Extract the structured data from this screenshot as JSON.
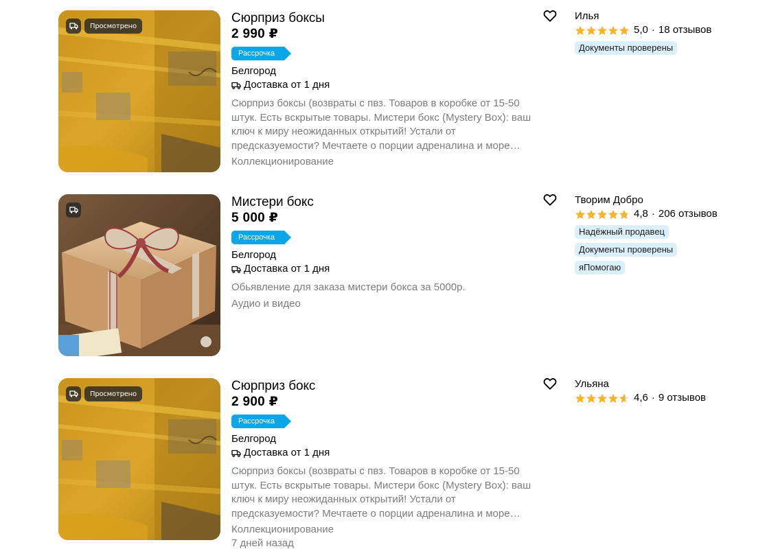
{
  "listings": [
    {
      "title": "Сюрприз боксы",
      "price": "2 990 ₽",
      "installment": "Рассрочка",
      "badge_seen": "Просмотрено",
      "city": "Белгород",
      "delivery": "Доставка от 1 дня",
      "description": "Сюрприз боксы (возвраты с пвз. Товаров в коробке от 15-50 штук. Есть вскрытые товары. Мистери бокс (Mystery Box): ваш ключ к миру неожиданных открытий! Устали от предсказуемости? Мечтаете о порции адреналина и море…",
      "category": "Коллекционирование",
      "seller": {
        "name": "Илья",
        "rating": "5,0",
        "rating_value": 5.0,
        "reviews": "18 отзывов",
        "tags": [
          "Документы проверены"
        ]
      }
    },
    {
      "title": "Мистери бокс",
      "price": "5 000 ₽",
      "installment": "Рассрочка",
      "city": "Белгород",
      "delivery": "Доставка от 1 дня",
      "description": "Обьявление для заказа мистери бокса за 5000р.",
      "category": "Аудио и видео",
      "seller": {
        "name": "Творим Добро",
        "rating": "4,8",
        "rating_value": 4.8,
        "reviews": "206 отзывов",
        "tags": [
          "Надёжный продавец",
          "Документы проверены",
          "яПомогаю"
        ]
      }
    },
    {
      "title": "Сюрприз бокс",
      "price": "2 900 ₽",
      "installment": "Рассрочка",
      "badge_seen": "Просмотрено",
      "city": "Белгород",
      "delivery": "Доставка от 1 дня",
      "description": "Сюрприз боксы (возвраты с пвз. Товаров в коробке от 15-50 штук. Есть вскрытые товары. Мистери бокс (Mystery Box): ваш ключ к миру неожиданных открытий! Устали от предсказуемости? Мечтаете о порции адреналина и море…",
      "category": "Коллекционирование",
      "date": "7 дней назад",
      "seller": {
        "name": "Ульяна",
        "rating": "4,6",
        "rating_value": 4.6,
        "reviews": "9 отзывов",
        "tags": []
      }
    }
  ],
  "colors": {
    "installment": "#0aa6e8",
    "star": "#f7b32b",
    "tag_bg": "#dcf0fb",
    "muted_text": "#7d7d7d"
  },
  "icons": {
    "favorite": "heart-outline-icon",
    "delivery": "truck-icon",
    "rating": "star-icon"
  }
}
